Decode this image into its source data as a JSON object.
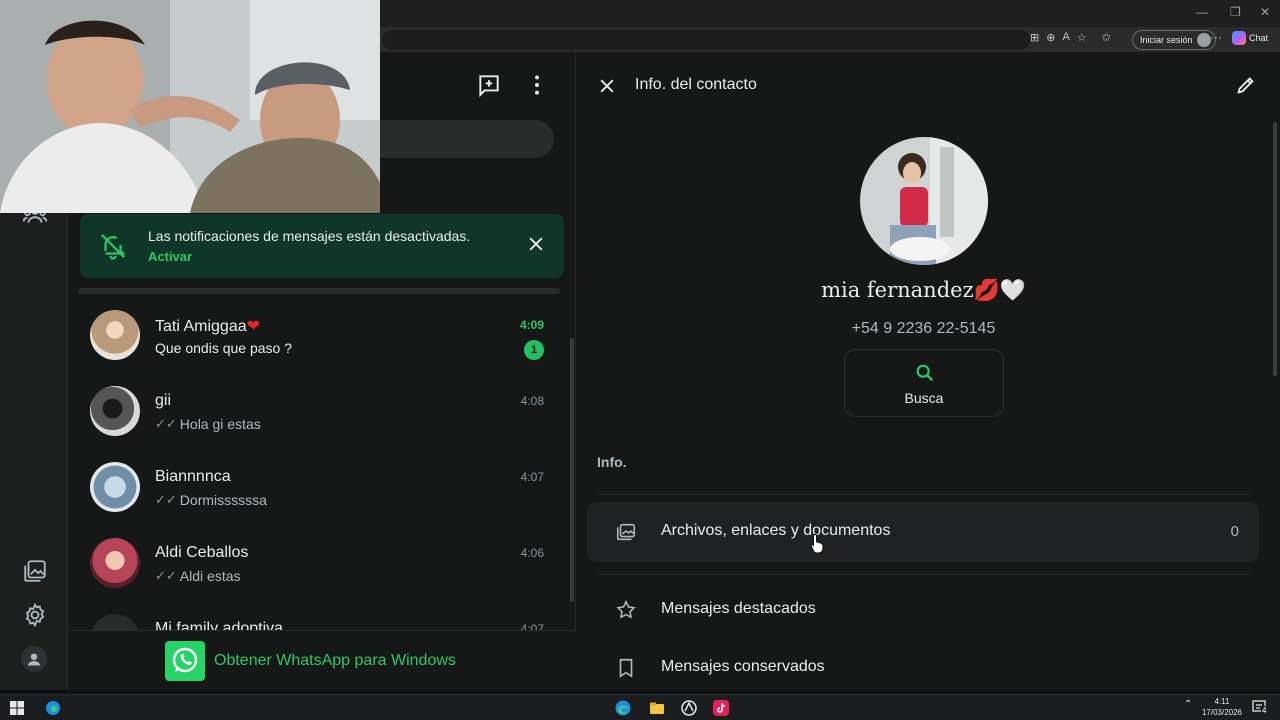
{
  "browser": {
    "signin_label": "Iniciar sesión",
    "chat_label": "Chat"
  },
  "notification": {
    "message": "Las notificaciones de mensajes están desactivadas.",
    "action": "Activar"
  },
  "chats": [
    {
      "name": "Tati Amiggaa",
      "name_suffix": "❤",
      "preview": "Que ondis que paso ?",
      "time": "4:09",
      "unread_count": "1",
      "read_ticks": false,
      "unread": true,
      "avatar_color": "#b89a7a"
    },
    {
      "name": "gii",
      "preview": "Hola gi estas",
      "time": "4:08",
      "read_ticks": true,
      "unread": false,
      "avatar_color": "#3a3a3a"
    },
    {
      "name": "Biannnnca",
      "preview": "Dormissssssa",
      "time": "4:07",
      "read_ticks": true,
      "unread": false,
      "avatar_color": "#6f8fa8"
    },
    {
      "name": "Aldi Ceballos",
      "preview": "Aldi estas",
      "time": "4:06",
      "read_ticks": true,
      "unread": false,
      "avatar_color": "#b6455a"
    },
    {
      "name": "Mi family adoptiva",
      "preview": "",
      "time": "4:07",
      "read_ticks": false,
      "unread": false,
      "avatar_color": "#2a2c2c"
    }
  ],
  "get_whatsapp": "Obtener WhatsApp para Windows",
  "contact_info": {
    "title": "Info. del contacto",
    "name": "mia fernandez",
    "name_emoji": "💋🤍",
    "phone": "+54 9 2236 22-5145",
    "search_label": "Busca",
    "section_label": "Info.",
    "menu": [
      {
        "label": "Archivos, enlaces y documentos",
        "count": "0",
        "icon": "media-gallery-icon"
      },
      {
        "label": "Mensajes destacados",
        "icon": "star-icon"
      },
      {
        "label": "Mensajes conservados",
        "icon": "bookmark-icon"
      }
    ]
  },
  "taskbar": {
    "time": "4:11",
    "date": "17/03/2026",
    "notification_count": "4"
  },
  "colors": {
    "accent": "#2fc765",
    "notification_bg": "#103529",
    "panel_bg": "#161717"
  }
}
